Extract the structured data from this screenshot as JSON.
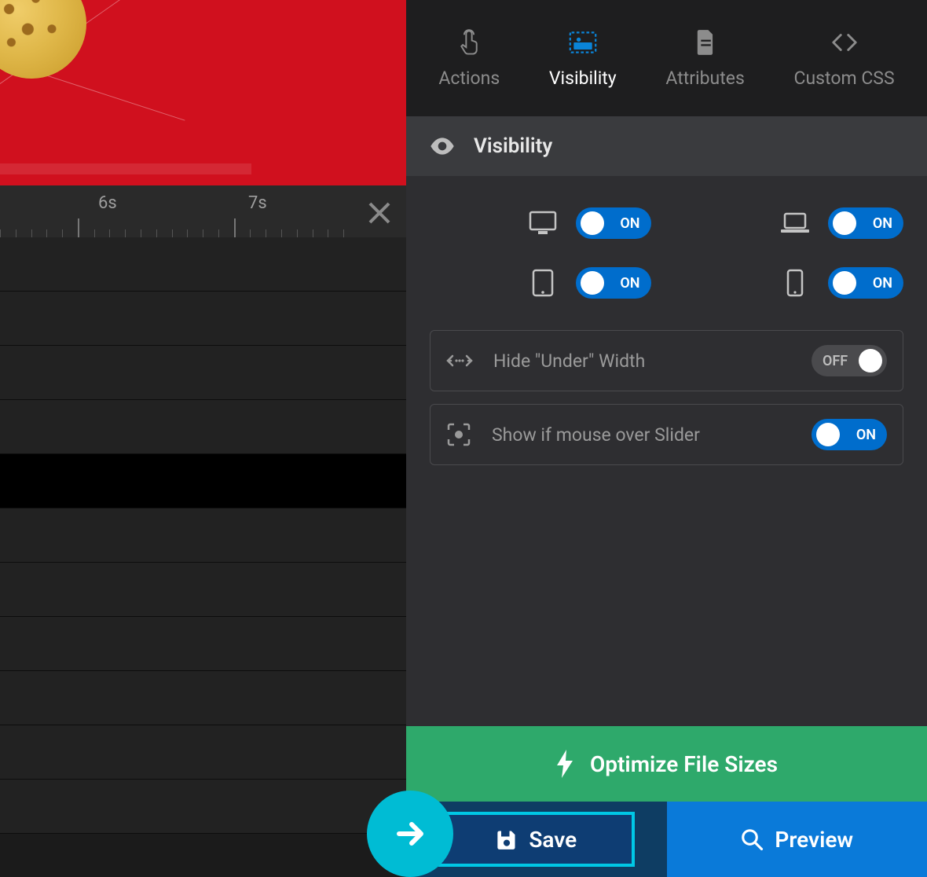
{
  "timeline": {
    "marks": [
      "6s",
      "7s"
    ]
  },
  "tabs": [
    {
      "label": "Actions"
    },
    {
      "label": "Visibility"
    },
    {
      "label": "Attributes"
    },
    {
      "label": "Custom CSS"
    }
  ],
  "section": {
    "title": "Visibility"
  },
  "devices": {
    "desktop": "ON",
    "laptop": "ON",
    "tablet": "ON",
    "mobile": "ON"
  },
  "options": {
    "hide_under_width": {
      "label": "Hide \"Under\" Width",
      "state": "OFF"
    },
    "show_mouse_over": {
      "label": "Show if mouse over Slider",
      "state": "ON"
    }
  },
  "footer": {
    "optimize": "Optimize File Sizes",
    "save": "Save",
    "preview": "Preview"
  }
}
